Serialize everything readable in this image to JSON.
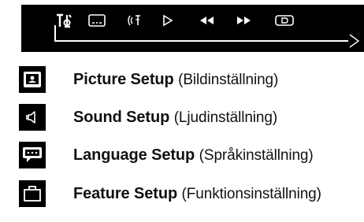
{
  "topbar": {
    "icons": [
      "settings-icon",
      "subtitle-icon",
      "audio-language-icon",
      "play-icon",
      "rewind-icon",
      "fast-forward-icon",
      "display-icon"
    ]
  },
  "menu": {
    "items": [
      {
        "icon": "picture-icon",
        "title": "Picture Setup",
        "subtitle": "(Bildinställning)"
      },
      {
        "icon": "speaker-icon",
        "title": "Sound Setup",
        "subtitle": "(Ljudinställning)"
      },
      {
        "icon": "speech-bubble-icon",
        "title": "Language Setup",
        "subtitle": "(Språkinställning)"
      },
      {
        "icon": "briefcase-icon",
        "title": "Feature Setup",
        "subtitle": "(Funktionsinställning)"
      }
    ]
  },
  "colors": {
    "osd_background": "#000000",
    "osd_foreground": "#ffffff",
    "text": "#111111"
  }
}
